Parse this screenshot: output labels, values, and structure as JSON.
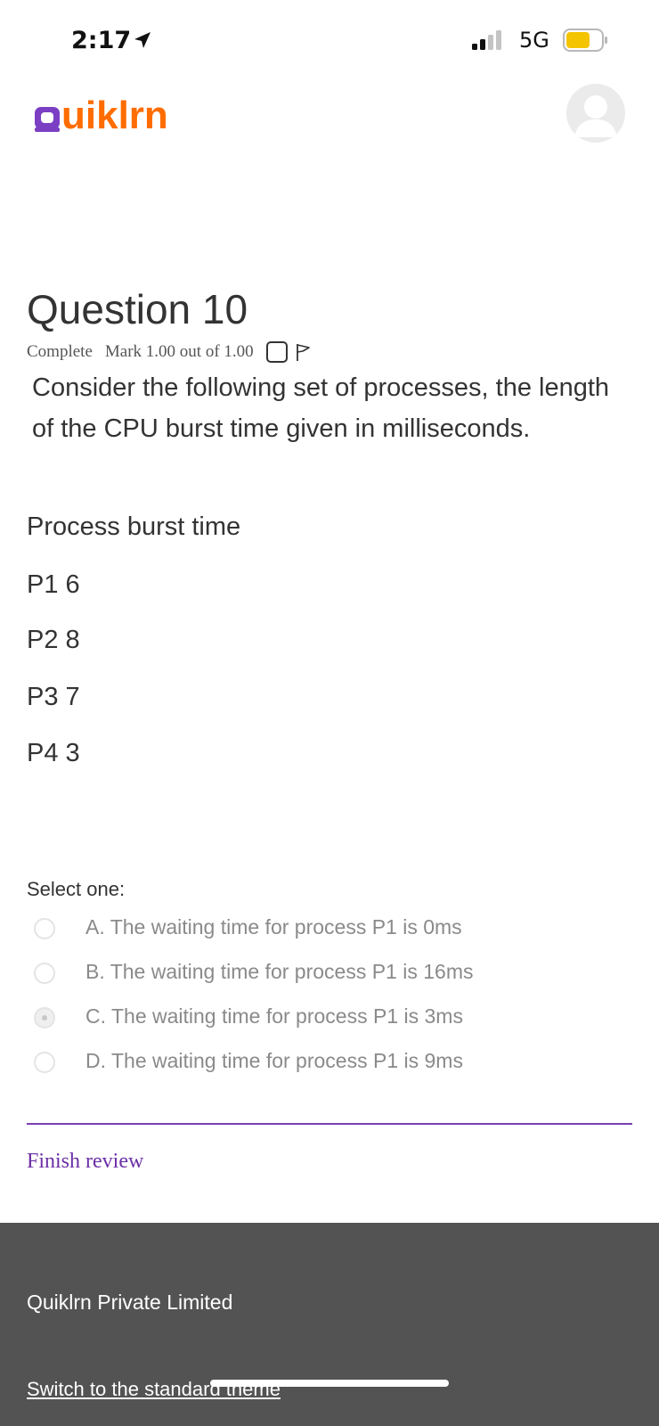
{
  "status_bar": {
    "time": "2:17",
    "network": "5G",
    "battery_color": "#f5c400"
  },
  "header": {
    "logo_q": "Q",
    "logo_rest": "uiklrn",
    "logo_q_color": "#7b3fc4",
    "logo_color": "#ff6d00"
  },
  "question": {
    "title": "Question 10",
    "state": "Complete",
    "mark": "Mark 1.00 out of 1.00",
    "text": [
      "Consider the following set of processes, the length of the CPU burst time given in milliseconds."
    ],
    "table_header": "Process burst time",
    "processes": [
      "P1 6",
      "P2 8",
      "P3 7",
      "P4 3"
    ]
  },
  "answer": {
    "prompt": "Select one:",
    "options": [
      {
        "label": "A. The waiting time for process P1 is 0ms",
        "selected": false
      },
      {
        "label": "B. The waiting time for process P1 is 16ms",
        "selected": false
      },
      {
        "label": "C. The waiting time for process P1 is 3ms",
        "selected": true
      },
      {
        "label": "D. The waiting time for process P1 is 9ms",
        "selected": false
      }
    ]
  },
  "navigation": {
    "finish_review": "Finish review"
  },
  "footer": {
    "company": "Quiklrn Private Limited",
    "switch_theme": "Switch to the standard theme"
  }
}
